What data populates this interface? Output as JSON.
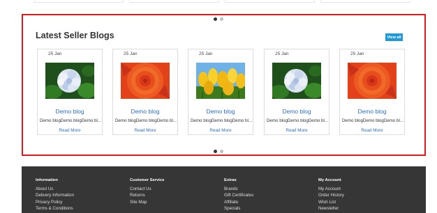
{
  "section": {
    "title": "Latest Seller Blogs",
    "view_all_label": "View all"
  },
  "blogs": [
    {
      "date": "25 Jan",
      "image": "white-blue-hydrangea-flower",
      "title": "Demo blog",
      "excerpt": "Demo blogDemo blogDemo bl...",
      "read_more": "Read More"
    },
    {
      "date": "25 Jan",
      "image": "red-orange-dahlia-flower",
      "title": "Demo blog",
      "excerpt": "Demo blogDemo blogDemo bl...",
      "read_more": "Read More"
    },
    {
      "date": "25 Jan",
      "image": "yellow-tulips-flower",
      "title": "Demo blog",
      "excerpt": "Demo blogDemo blogDemo bl...",
      "read_more": "Read More"
    },
    {
      "date": "25 Jan",
      "image": "white-blue-hydrangea-flower",
      "title": "Demo blog",
      "excerpt": "Demo blogDemo blogDemo bl...",
      "read_more": "Read More"
    },
    {
      "date": "25 Jan",
      "image": "red-orange-dahlia-flower",
      "title": "Demo blog",
      "excerpt": "Demo blogDemo blogDemo bl...",
      "read_more": "Read More"
    }
  ],
  "carousel": {
    "pages": 2,
    "active_page": 1
  },
  "footer": {
    "columns": [
      {
        "heading": "Information",
        "links": [
          "About Us",
          "Delivery Information",
          "Privacy Policy",
          "Terms & Conditions"
        ]
      },
      {
        "heading": "Customer Service",
        "links": [
          "Contact Us",
          "Returns",
          "Site Map"
        ]
      },
      {
        "heading": "Extras",
        "links": [
          "Brands",
          "Gift Certificates",
          "Affiliate",
          "Specials"
        ]
      },
      {
        "heading": "My Account",
        "links": [
          "My Account",
          "Order History",
          "Wish List",
          "Newsletter"
        ]
      }
    ]
  },
  "colors": {
    "highlight_border": "#e0181b",
    "accent_blue": "#1f9ad6",
    "link_blue": "#2a6fc9",
    "footer_bg": "#363636"
  }
}
